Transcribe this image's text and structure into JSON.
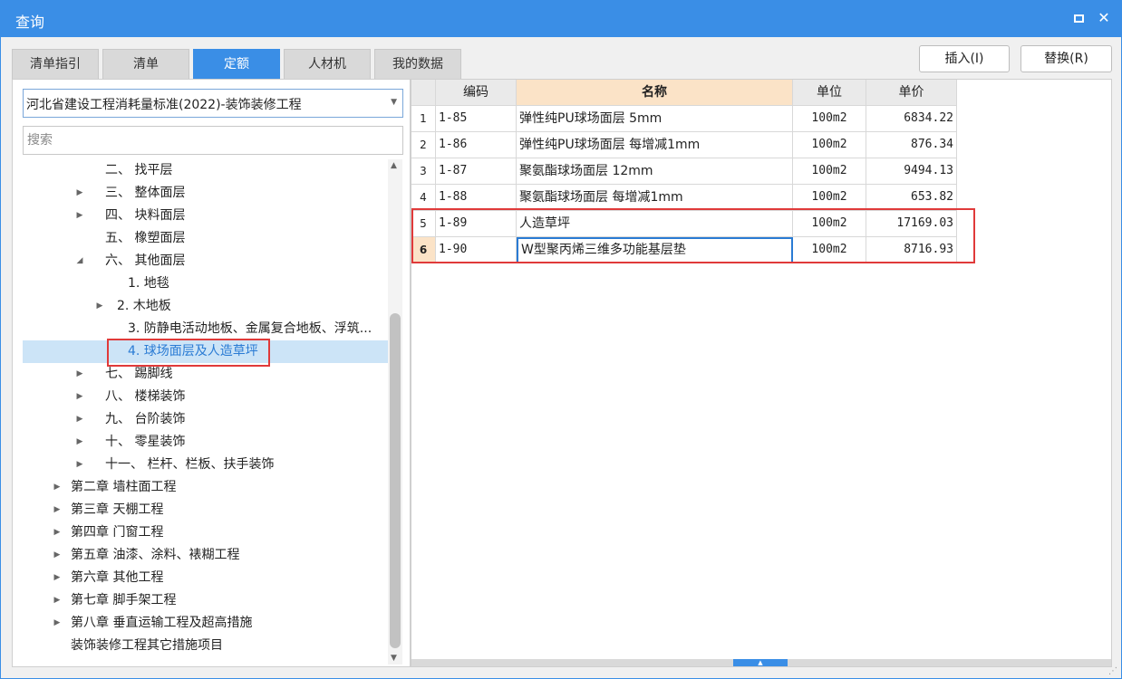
{
  "window": {
    "title": "查询"
  },
  "tabs": [
    {
      "label": "清单指引",
      "active": false
    },
    {
      "label": "清单",
      "active": false
    },
    {
      "label": "定额",
      "active": true
    },
    {
      "label": "人材机",
      "active": false
    },
    {
      "label": "我的数据",
      "active": false
    }
  ],
  "buttons": {
    "insert": "插入(I)",
    "replace": "替换(R)"
  },
  "left": {
    "standard_selected": "河北省建设工程消耗量标准(2022)-装饰装修工程",
    "search_placeholder": "搜索",
    "tree": [
      {
        "label": "二、 找平层",
        "expander": "none",
        "selected": false
      },
      {
        "label": "三、 整体面层",
        "expander": "collapsed",
        "selected": false
      },
      {
        "label": "四、 块料面层",
        "expander": "collapsed",
        "selected": false
      },
      {
        "label": "五、 橡塑面层",
        "expander": "none",
        "selected": false
      },
      {
        "label": "六、 其他面层",
        "expander": "expanded",
        "selected": false
      },
      {
        "label": "1. 地毯",
        "expander": "none",
        "selected": false
      },
      {
        "label": "2. 木地板",
        "expander": "collapsed",
        "selected": false
      },
      {
        "label": "3. 防静电活动地板、金属复合地板、浮筑...",
        "expander": "none",
        "selected": false
      },
      {
        "label": "4. 球场面层及人造草坪",
        "expander": "none",
        "selected": true
      },
      {
        "label": "七、 踢脚线",
        "expander": "collapsed",
        "selected": false
      },
      {
        "label": "八、 楼梯装饰",
        "expander": "collapsed",
        "selected": false
      },
      {
        "label": "九、 台阶装饰",
        "expander": "collapsed",
        "selected": false
      },
      {
        "label": "十、 零星装饰",
        "expander": "collapsed",
        "selected": false
      },
      {
        "label": "十一、 栏杆、栏板、扶手装饰",
        "expander": "collapsed",
        "selected": false
      },
      {
        "label": "第二章 墙柱面工程",
        "expander": "collapsed",
        "selected": false
      },
      {
        "label": "第三章 天棚工程",
        "expander": "collapsed",
        "selected": false
      },
      {
        "label": "第四章 门窗工程",
        "expander": "collapsed",
        "selected": false
      },
      {
        "label": "第五章 油漆、涂料、裱糊工程",
        "expander": "collapsed",
        "selected": false
      },
      {
        "label": "第六章 其他工程",
        "expander": "collapsed",
        "selected": false
      },
      {
        "label": "第七章 脚手架工程",
        "expander": "collapsed",
        "selected": false
      },
      {
        "label": "第八章 垂直运输工程及超高措施",
        "expander": "collapsed",
        "selected": false
      },
      {
        "label": "装饰装修工程其它措施项目",
        "expander": "none",
        "selected": false
      }
    ]
  },
  "table": {
    "columns": [
      "",
      "编码",
      "名称",
      "单位",
      "单价"
    ],
    "sorted_column": "名称",
    "rows": [
      {
        "num": "1",
        "code": "1-85",
        "name": "弹性纯PU球场面层 5mm",
        "unit": "100m2",
        "price": "6834.22"
      },
      {
        "num": "2",
        "code": "1-86",
        "name": "弹性纯PU球场面层 每增减1mm",
        "unit": "100m2",
        "price": "876.34"
      },
      {
        "num": "3",
        "code": "1-87",
        "name": "聚氨酯球场面层 12mm",
        "unit": "100m2",
        "price": "9494.13"
      },
      {
        "num": "4",
        "code": "1-88",
        "name": "聚氨酯球场面层 每增减1mm",
        "unit": "100m2",
        "price": "653.82"
      },
      {
        "num": "5",
        "code": "1-89",
        "name": "人造草坪",
        "unit": "100m2",
        "price": "17169.03"
      },
      {
        "num": "6",
        "code": "1-90",
        "name": "W型聚丙烯三维多功能基层垫",
        "unit": "100m2",
        "price": "8716.93"
      }
    ],
    "current_row": "6"
  },
  "colors": {
    "accent": "#3a8ee6",
    "highlight_red": "#e03a3a",
    "header_sorted": "#fbe3c7",
    "selected_row": "#cce4f7"
  }
}
